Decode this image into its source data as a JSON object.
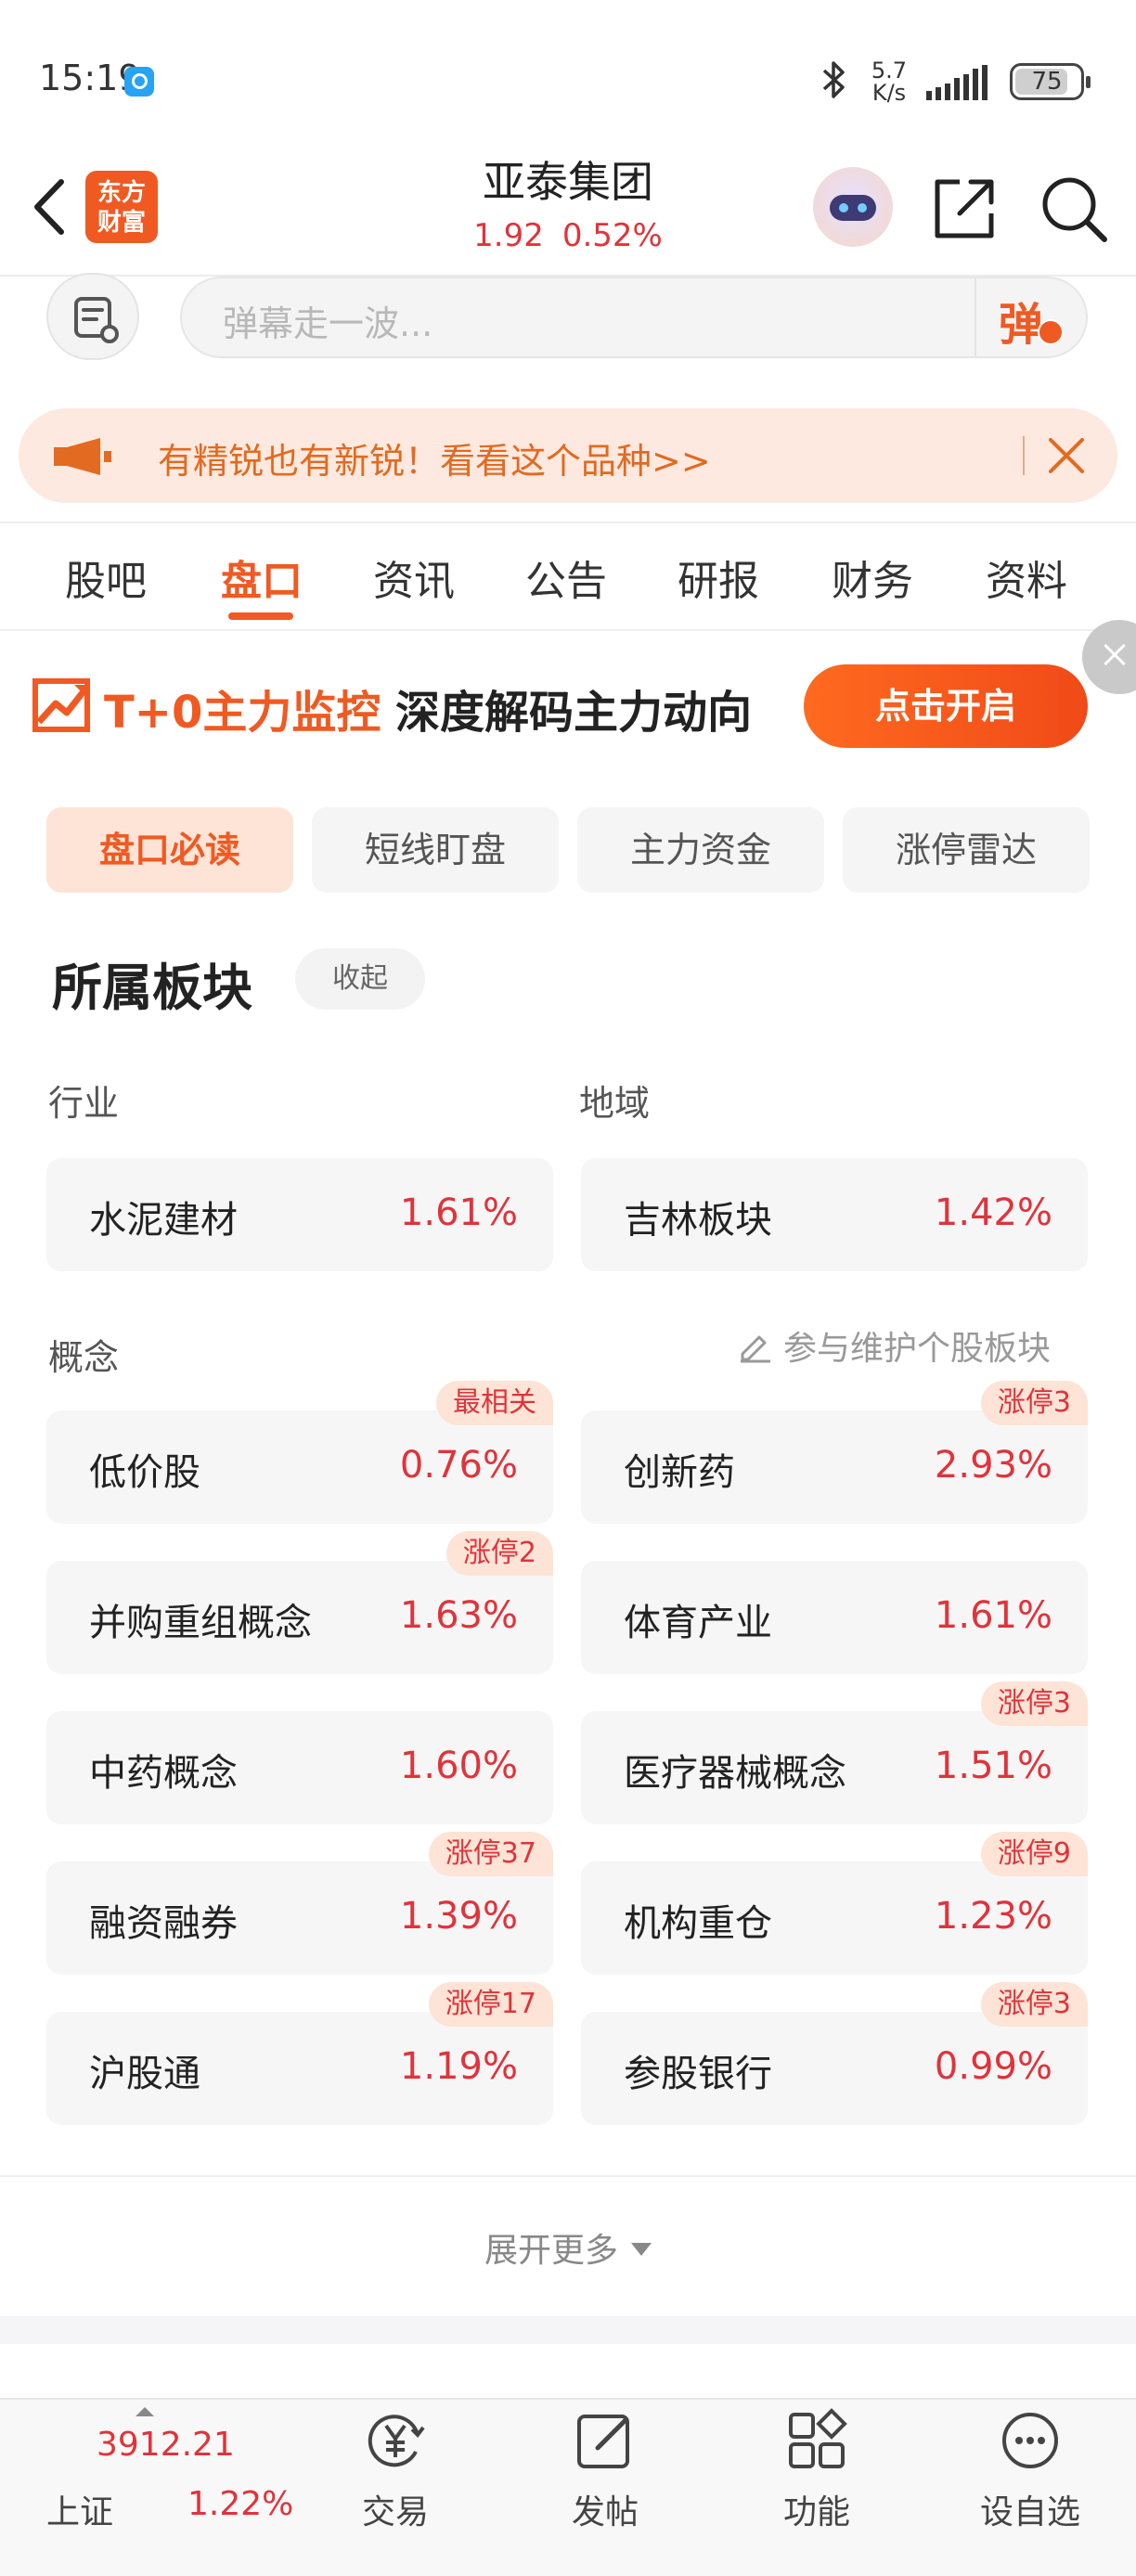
{
  "status_bar": {
    "time": "15:19",
    "speed_value": "5.7",
    "speed_unit": "K/s",
    "battery": "75"
  },
  "header": {
    "logo_line1": "东方",
    "logo_line2": "财富",
    "stock_name": "亚泰集团",
    "price": "1.92",
    "change_pct": "0.52%"
  },
  "danmaku": {
    "placeholder": "弹幕走一波...",
    "button": "弹"
  },
  "promo": {
    "text": "有精锐也有新锐！看看这个品种>>"
  },
  "tabs": [
    "股吧",
    "盘口",
    "资讯",
    "公告",
    "研报",
    "财务",
    "资料"
  ],
  "active_tab": "盘口",
  "ad": {
    "title": "T+0主力监控",
    "subtitle": "深度解码主力动向",
    "button": "点击开启"
  },
  "subtabs": [
    "盘口必读",
    "短线盯盘",
    "主力资金",
    "涨停雷达"
  ],
  "section": {
    "title": "所属板块",
    "collapse": "收起"
  },
  "industry": {
    "label": "行业",
    "name": "水泥建材",
    "pct": "1.61%"
  },
  "region": {
    "label": "地域",
    "name": "吉林板块",
    "pct": "1.42%"
  },
  "concept": {
    "label": "概念",
    "maintain_link": "参与维护个股板块",
    "items": [
      {
        "name": "低价股",
        "pct": "0.76%",
        "badge": "最相关"
      },
      {
        "name": "创新药",
        "pct": "2.93%",
        "badge": "涨停3"
      },
      {
        "name": "并购重组概念",
        "pct": "1.63%",
        "badge": "涨停2"
      },
      {
        "name": "体育产业",
        "pct": "1.61%",
        "badge": ""
      },
      {
        "name": "中药概念",
        "pct": "1.60%",
        "badge": ""
      },
      {
        "name": "医疗器械概念",
        "pct": "1.51%",
        "badge": "涨停3"
      },
      {
        "name": "融资融券",
        "pct": "1.39%",
        "badge": "涨停37"
      },
      {
        "name": "机构重仓",
        "pct": "1.23%",
        "badge": "涨停9"
      },
      {
        "name": "沪股通",
        "pct": "1.19%",
        "badge": "涨停17"
      },
      {
        "name": "参股银行",
        "pct": "0.99%",
        "badge": "涨停3"
      }
    ]
  },
  "expand_more": "展开更多",
  "bottom_bar": {
    "index_value": "3912.21",
    "index_name": "上证",
    "index_pct": "1.22%",
    "nav": [
      "交易",
      "发帖",
      "功能",
      "设自选"
    ]
  },
  "colors": {
    "accent": "#f05a22",
    "rise": "#e0333b",
    "badge_bg": "#fde4d6"
  }
}
